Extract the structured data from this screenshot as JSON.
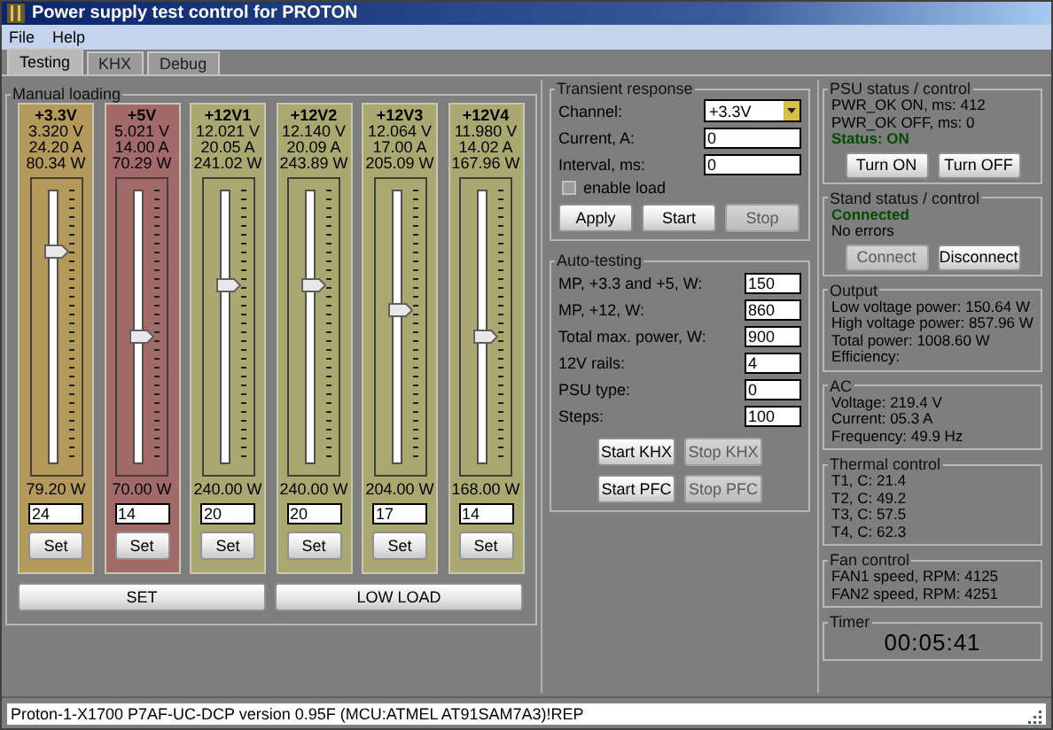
{
  "window": {
    "title": "Power supply test control for PROTON"
  },
  "menu": [
    "File",
    "Help"
  ],
  "tabs": [
    {
      "label": "Testing",
      "selected": true
    },
    {
      "label": "KHX",
      "selected": false
    },
    {
      "label": "Debug",
      "selected": false
    }
  ],
  "manual_loading": {
    "title": "Manual loading",
    "channels": [
      {
        "name": "+3.3V",
        "voltage": "3.320 V",
        "current": "24.20 A",
        "power": "80.34 W",
        "color": "#b49a5a",
        "level": 0.8,
        "load_power": "79.20 W",
        "setpoint": "24",
        "button": "Set"
      },
      {
        "name": "+5V",
        "voltage": "5.021 V",
        "current": "14.00 A",
        "power": "70.29 W",
        "color": "#a26a68",
        "level": 0.47,
        "load_power": "70.00 W",
        "setpoint": "14",
        "button": "Set"
      },
      {
        "name": "+12V1",
        "voltage": "12.021 V",
        "current": "20.05 A",
        "power": "241.02 W",
        "color": "#a8a870",
        "level": 0.67,
        "load_power": "240.00 W",
        "setpoint": "20",
        "button": "Set"
      },
      {
        "name": "+12V2",
        "voltage": "12.140 V",
        "current": "20.09 A",
        "power": "243.89 W",
        "color": "#a8a870",
        "level": 0.67,
        "load_power": "240.00 W",
        "setpoint": "20",
        "button": "Set"
      },
      {
        "name": "+12V3",
        "voltage": "12.064 V",
        "current": "17.00 A",
        "power": "205.09 W",
        "color": "#a8a870",
        "level": 0.57,
        "load_power": "204.00 W",
        "setpoint": "17",
        "button": "Set"
      },
      {
        "name": "+12V4",
        "voltage": "11.980 V",
        "current": "14.02 A",
        "power": "167.96 W",
        "color": "#a8a870",
        "level": 0.47,
        "load_power": "168.00 W",
        "setpoint": "14",
        "button": "Set"
      }
    ],
    "buttons": [
      "SET",
      "LOW LOAD"
    ]
  },
  "transient_response": {
    "title": "Transient response",
    "fields": [
      {
        "label": "Channel:",
        "value": "+3.3V",
        "kind": "dropdown"
      },
      {
        "label": "Current, A:",
        "value": "0",
        "kind": "text"
      },
      {
        "label": "Interval, ms:",
        "value": "0",
        "kind": "text"
      }
    ],
    "enable_load": {
      "label": "enable load",
      "checked": false
    },
    "buttons": [
      {
        "label": "Apply",
        "disabled": false
      },
      {
        "label": "Start",
        "disabled": false
      },
      {
        "label": "Stop",
        "disabled": true
      }
    ]
  },
  "auto_testing": {
    "title": "Auto-testing",
    "fields": [
      {
        "label": "MP, +3.3 and +5, W:",
        "value": "150"
      },
      {
        "label": "MP, +12, W:",
        "value": "860"
      },
      {
        "label": "Total max. power, W:",
        "value": "900"
      },
      {
        "label": "12V rails:",
        "value": "4"
      },
      {
        "label": "PSU type:",
        "value": "0"
      },
      {
        "label": "Steps:",
        "value": "100"
      }
    ],
    "button_rows": [
      [
        {
          "label": "Start KHX",
          "disabled": false
        },
        {
          "label": "Stop KHX",
          "disabled": true
        }
      ],
      [
        {
          "label": "Start PFC",
          "disabled": false
        },
        {
          "label": "Stop PFC",
          "disabled": true
        }
      ]
    ]
  },
  "status_panels": [
    {
      "title": "PSU status / control",
      "lines": [
        {
          "text": "PWR_OK ON, ms: 412",
          "kind": "info"
        },
        {
          "text": "PWR_OK OFF, ms: 0",
          "kind": "info"
        },
        {
          "text": "Status: ON",
          "kind": "ok"
        }
      ],
      "buttons": [
        {
          "label": "Turn ON",
          "disabled": false
        },
        {
          "label": "Turn OFF",
          "disabled": false
        }
      ]
    },
    {
      "title": "Stand status / control",
      "lines": [
        {
          "text": "Connected",
          "kind": "ok"
        },
        {
          "text": "No errors",
          "kind": "info"
        }
      ],
      "buttons": [
        {
          "label": "Connect",
          "disabled": true
        },
        {
          "label": "Disconnect",
          "disabled": false
        }
      ]
    },
    {
      "title": "Output",
      "lines": [
        {
          "text": "Low voltage power: 150.64 W",
          "kind": "info"
        },
        {
          "text": "High voltage power: 857.96 W",
          "kind": "info"
        },
        {
          "text": "Total power: 1008.60 W",
          "kind": "info"
        },
        {
          "text": "Efficiency:",
          "kind": "info"
        }
      ]
    },
    {
      "title": "AC",
      "lines": [
        {
          "text": "Voltage: 219.4 V",
          "kind": "info"
        },
        {
          "text": "Current: 05.3 A",
          "kind": "info"
        },
        {
          "text": "Frequency: 49.9 Hz",
          "kind": "info"
        }
      ]
    },
    {
      "title": "Thermal control",
      "lines": [
        {
          "text": "T1, C: 21.4",
          "kind": "info"
        },
        {
          "text": "T2, C: 49.2",
          "kind": "info"
        },
        {
          "text": "T3, C: 57.5",
          "kind": "info"
        },
        {
          "text": "T4, C: 62.3",
          "kind": "info"
        }
      ]
    },
    {
      "title": "Fan control",
      "lines": [
        {
          "text": "FAN1 speed, RPM: 4125",
          "kind": "info"
        },
        {
          "text": "FAN2 speed, RPM: 4251",
          "kind": "info"
        }
      ]
    }
  ],
  "timer": {
    "title": "Timer",
    "value": "00:05:41"
  },
  "status_bar": "Proton-1-X1700 P7AF-UC-DCP version 0.95F (MCU:ATMEL AT91SAM7A3)!REP"
}
